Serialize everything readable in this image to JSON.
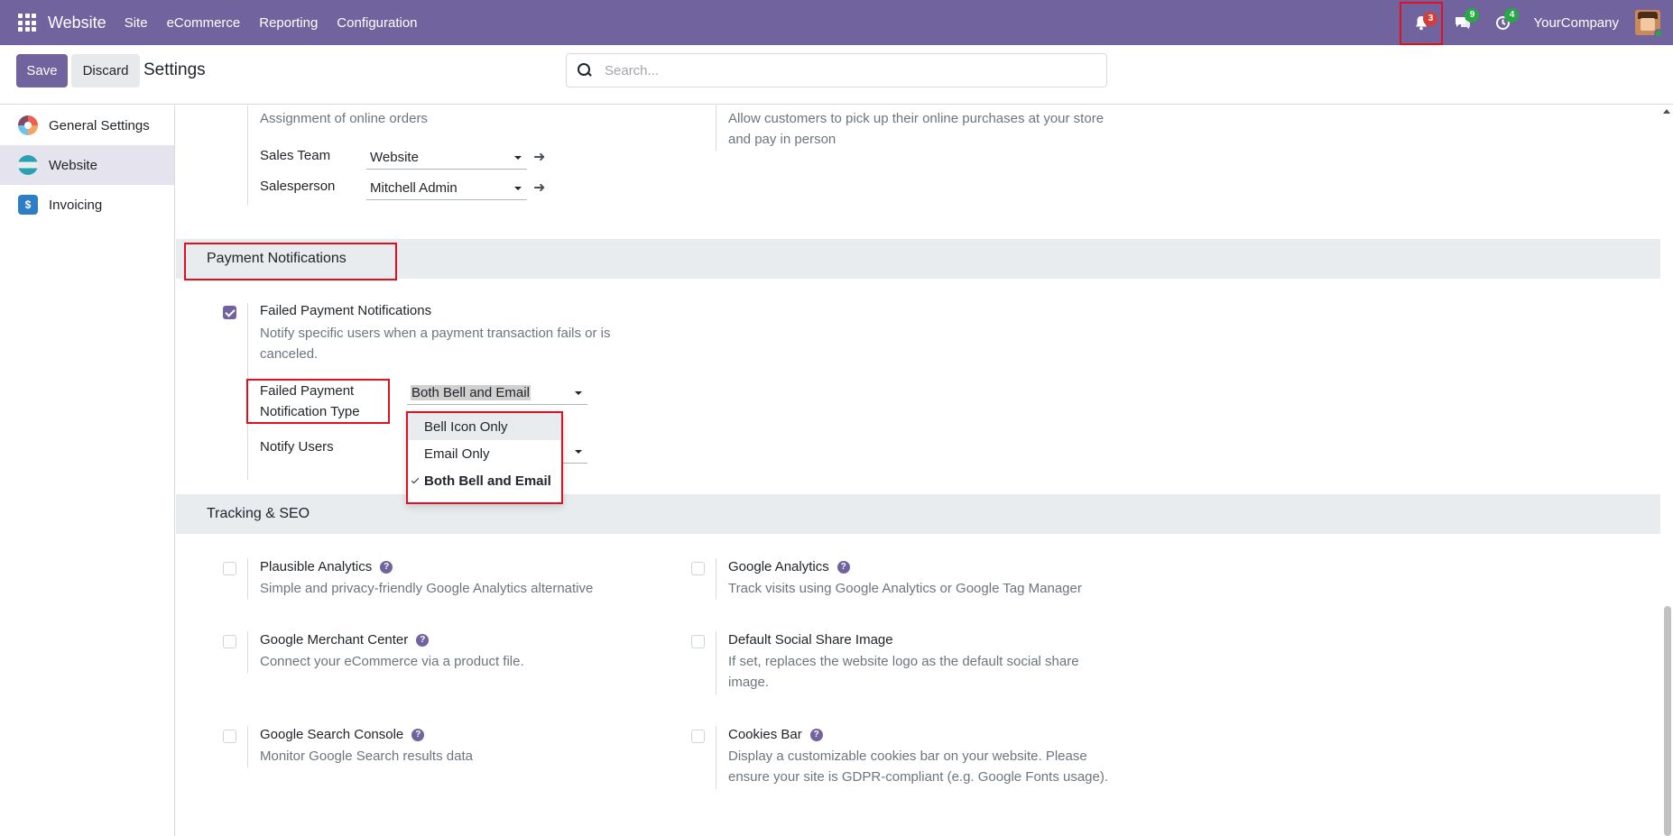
{
  "navbar": {
    "app_title": "Website",
    "menu": [
      "Site",
      "eCommerce",
      "Reporting",
      "Configuration"
    ],
    "activity_count": "3",
    "messages_count": "9",
    "timer_count": "4",
    "company": "YourCompany"
  },
  "control_panel": {
    "save_label": "Save",
    "discard_label": "Discard",
    "breadcrumb": "Settings",
    "search_placeholder": "Search..."
  },
  "sidebar": {
    "items": [
      {
        "label": "General Settings",
        "icon": "general-settings-icon"
      },
      {
        "label": "Website",
        "icon": "website-app-icon"
      },
      {
        "label": "Invoicing",
        "icon": "invoicing-app-icon"
      }
    ],
    "active": "Website"
  },
  "assignment": {
    "desc": "Assignment of online orders",
    "sales_team_label": "Sales Team",
    "sales_team_value": "Website",
    "salesperson_label": "Salesperson",
    "salesperson_value": "Mitchell Admin"
  },
  "pickup": {
    "desc": "Allow customers to pick up their online purchases at your store and pay in person"
  },
  "payment_section": {
    "title": "Payment Notifications",
    "failed_title": "Failed Payment Notifications",
    "failed_desc": "Notify specific users when a payment transaction fails or is canceled.",
    "failed_checked": true,
    "type_label": "Failed Payment Notification Type",
    "type_value": "Both Bell and Email",
    "notify_users_label": "Notify Users",
    "type_options": [
      "Bell Icon Only",
      "Email Only",
      "Both Bell and Email"
    ]
  },
  "tracking_section": {
    "title": "Tracking & SEO",
    "settings": [
      {
        "title": "Plausible Analytics",
        "desc": "Simple and privacy-friendly Google Analytics alternative"
      },
      {
        "title": "Google Analytics",
        "desc": "Track visits using Google Analytics or Google Tag Manager"
      },
      {
        "title": "Google Merchant Center",
        "desc": "Connect your eCommerce via a product file."
      },
      {
        "title": "Default Social Share Image",
        "desc": "If set, replaces the website logo as the default social share image."
      },
      {
        "title": "Google Search Console",
        "desc": "Monitor Google Search results data"
      },
      {
        "title": "Cookies Bar",
        "desc": "Display a customizable cookies bar on your website. Please ensure your site is GDPR-compliant (e.g. Google Fonts usage)."
      }
    ]
  },
  "colors": {
    "brand": "#71639e",
    "highlight": "#e0101e",
    "badge_red": "#d23f3a",
    "badge_green": "#28a745"
  }
}
